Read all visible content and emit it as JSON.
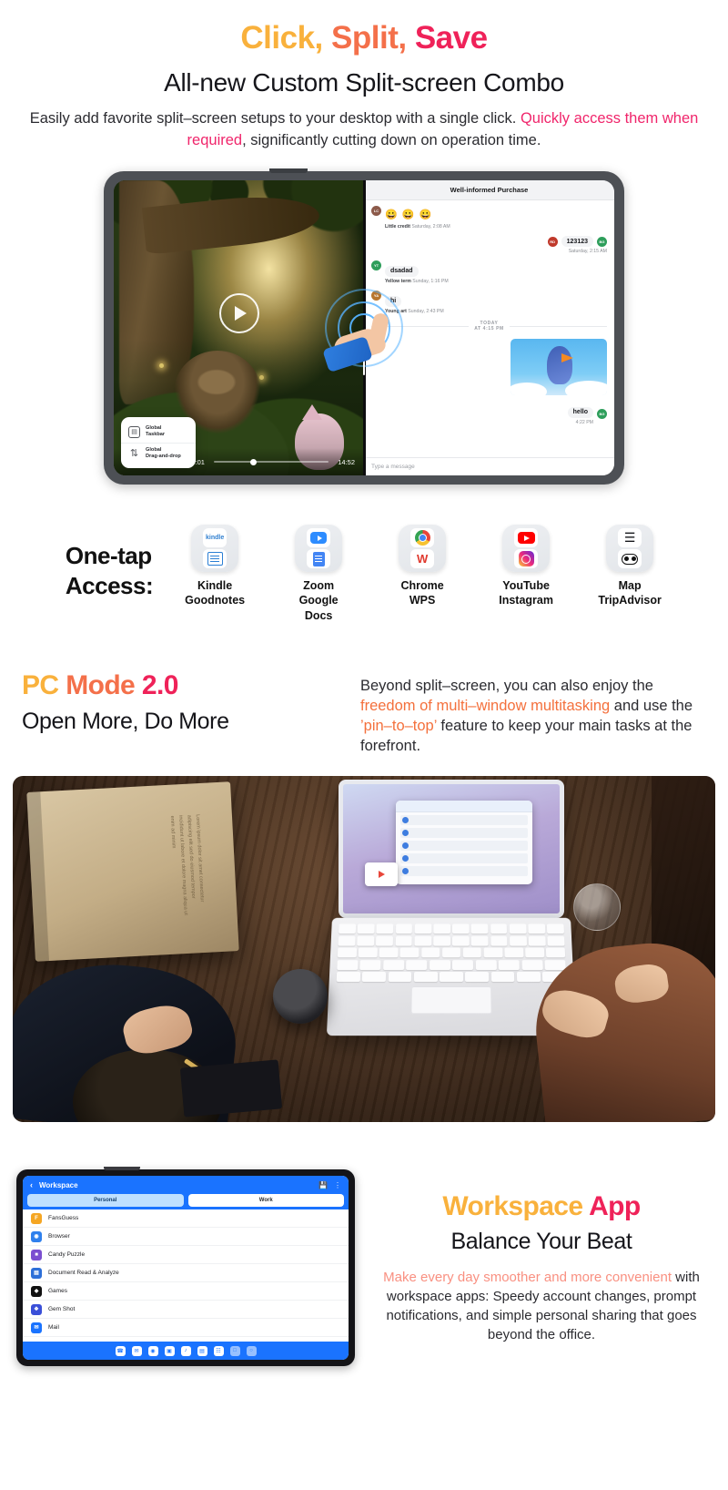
{
  "hero": {
    "title_parts": [
      "Click,",
      "Split,",
      "Save"
    ],
    "subtitle": "All-new Custom Split-screen Combo",
    "desc_1": "Easily add favorite split–screen setups to your desktop with a single click. ",
    "desc_highlight": "Quickly access them when required",
    "desc_2": ", significantly cutting down on operation time."
  },
  "tablet": {
    "video": {
      "current_time": "10:01",
      "total_time": "14:52",
      "rewind_icon": "rewind-icon",
      "play_icon": "play-icon",
      "forward_icon": "forward-icon"
    },
    "chat": {
      "title": "Well-informed Purchase",
      "input_placeholder": "Type a message",
      "messages": [
        {
          "side": "in",
          "avatar": "LC",
          "avatar_color": "#8c5a4a",
          "text": "😀 😀 😀",
          "emoji": true,
          "sender": "Little credit",
          "time": "Saturday, 2:08 AM"
        },
        {
          "side": "out",
          "avatar": "RD",
          "avatar_color": "#c0392b",
          "text": "123123",
          "emoji": false,
          "sender": "",
          "time": "Saturday, 2:15 AM"
        },
        {
          "side": "in",
          "avatar": "YT",
          "avatar_color": "#2e9e5b",
          "text": "dsadad",
          "emoji": false,
          "sender": "Yellow term",
          "time": "Sunday, 1:16 PM"
        },
        {
          "side": "in",
          "avatar": "YA",
          "avatar_color": "#b8762e",
          "text": "hi",
          "emoji": false,
          "sender": "Young art",
          "time": "Sunday, 2:43 PM"
        }
      ],
      "divider_label": "TODAY",
      "divider_time": "AT 4:15 PM",
      "sticker_label": "bird-sticker",
      "last_message": "hello",
      "last_message_time": "4:22 PM"
    },
    "popup": {
      "item1_line1": "Global",
      "item1_line2": "Taskbar",
      "item1_icon": "taskbar-icon",
      "item2_line1": "Global",
      "item2_line2": "Drag-and-drop",
      "item2_icon": "drag-drop-icon"
    }
  },
  "onetap": {
    "label_line1": "One-tap",
    "label_line2": "Access:",
    "apps": [
      {
        "name1": "Kindle",
        "name2": "Goodnotes",
        "icon_top": "kindle-icon",
        "icon_bottom": "goodnotes-icon"
      },
      {
        "name1": "Zoom",
        "name2": "Google Docs",
        "icon_top": "zoom-icon",
        "icon_bottom": "google-docs-icon"
      },
      {
        "name1": "Chrome",
        "name2": "WPS",
        "icon_top": "chrome-icon",
        "icon_bottom": "wps-icon"
      },
      {
        "name1": "YouTube",
        "name2": "Instagram",
        "icon_top": "youtube-icon",
        "icon_bottom": "instagram-icon"
      },
      {
        "name1": "Map",
        "name2": "TripAdvisor",
        "icon_top": "map-icon",
        "icon_bottom": "tripadvisor-icon"
      }
    ]
  },
  "pcmode": {
    "title_parts": [
      "PC ",
      "Mode ",
      "2.0"
    ],
    "subtitle": "Open More, Do More",
    "desc_1": "Beyond split–screen, you can also enjoy the ",
    "desc_hl1": "freedom of multi–window multitasking",
    "desc_2": " and use the ",
    "desc_hl2": "’pin–to–top’",
    "desc_3": " feature to keep your main tasks at the forefront."
  },
  "workspace": {
    "app": {
      "back_icon": "back-chevron-icon",
      "title": "Workspace",
      "save_icon": "save-icon",
      "more_icon": "more-vertical-icon",
      "tabs": [
        {
          "label": "Personal",
          "active": false
        },
        {
          "label": "Work",
          "active": true
        }
      ],
      "items": [
        {
          "label": "FansGuess",
          "icon": "fansguess-icon",
          "color": "#f5a623",
          "glyph": "F"
        },
        {
          "label": "Browser",
          "icon": "browser-icon",
          "color": "#2f80ed",
          "glyph": "◎"
        },
        {
          "label": "Candy Puzzle",
          "icon": "candy-icon",
          "color": "#7b4fd0",
          "glyph": "■"
        },
        {
          "label": "Document Read & Analyze",
          "icon": "document-icon",
          "color": "#2d6fd8",
          "glyph": "▤"
        },
        {
          "label": "Games",
          "icon": "games-icon",
          "color": "#111111",
          "glyph": "♦"
        },
        {
          "label": "Gem Shot",
          "icon": "gem-icon",
          "color": "#3a4fd8",
          "glyph": "❖"
        },
        {
          "label": "Mail",
          "icon": "mail-icon",
          "color": "#1a73ff",
          "glyph": "✉"
        }
      ],
      "dock_icons": [
        "phone-icon",
        "message-icon",
        "camera-icon",
        "gallery-icon",
        "music-icon",
        "files-icon",
        "apps-icon",
        "recent-icon",
        "home-icon"
      ]
    },
    "title_parts": [
      "Workspace ",
      "App"
    ],
    "subtitle": "Balance Your Beat",
    "desc_hl": "Make every day smoother and more convenient",
    "desc_rest": " with workspace apps: Speedy account changes, prompt notifications, and simple personal sharing that goes beyond the office."
  },
  "colors": {
    "gold": "#f9b13c",
    "orange": "#f4704a",
    "pink": "#ef2259",
    "blue": "#1a73ff",
    "salmon": "#f99081"
  }
}
